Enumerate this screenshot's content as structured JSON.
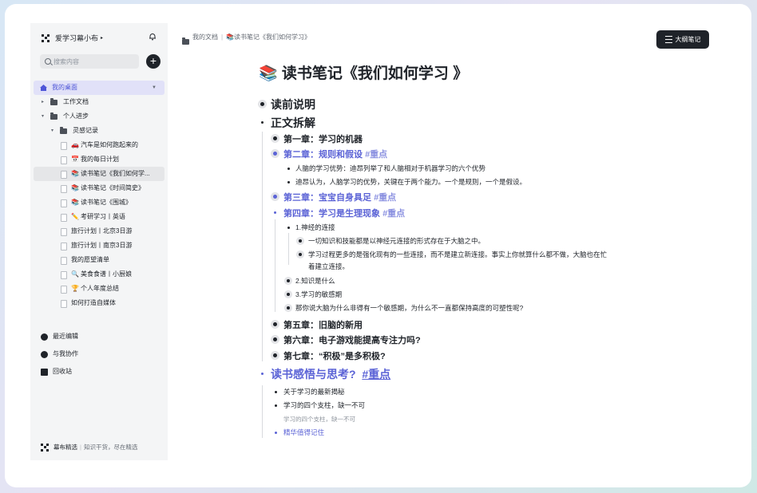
{
  "workspace": {
    "name": "爱学习幕小布",
    "caret": "▸"
  },
  "search": {
    "placeholder": "搜索内容"
  },
  "sidebar": {
    "desk": "我的桌面",
    "tree": [
      {
        "label": "工作文档",
        "emoji": ""
      },
      {
        "label": "个人进步",
        "emoji": ""
      },
      {
        "label": "灵感记录",
        "emoji": ""
      },
      {
        "label": "汽车是如何跑起来的",
        "emoji": "🚗"
      },
      {
        "label": "我的每日计划",
        "emoji": "📅"
      },
      {
        "label": "读书笔记《我们如何学...",
        "emoji": "📚"
      },
      {
        "label": "读书笔记《时间简史》",
        "emoji": "📚"
      },
      {
        "label": "读书笔记《围城》",
        "emoji": "📚"
      },
      {
        "label": "考研学习丨英语",
        "emoji": "✏️"
      },
      {
        "label": "旅行计划丨北京3日游",
        "emoji": ""
      },
      {
        "label": "旅行计划丨南京3日游",
        "emoji": ""
      },
      {
        "label": "我的愿望清单",
        "emoji": ""
      },
      {
        "label": "美食食谱丨小厨娘",
        "emoji": "🔍"
      },
      {
        "label": "个人年度总结",
        "emoji": "🏆"
      },
      {
        "label": "如何打造自媒体",
        "emoji": ""
      }
    ],
    "recent": "最近编辑",
    "collab": "与我协作",
    "trash": "回收站",
    "footer_brand": "幕布精选",
    "footer_slogan": "知识干货，尽在精选"
  },
  "breadcrumb": {
    "root": "我的文档",
    "current": "📚读书笔记《我们如何学习》"
  },
  "outline_button": "大纲笔记",
  "doc": {
    "title": "📚 读书笔记《我们如何学习 》",
    "pre": "读前说明",
    "body": "正文拆解",
    "ch1": "第一章：学习的机器",
    "ch2": "第二章：规则和假设",
    "ch2_tag": "#重点",
    "ch2_p1": "人脑的学习优势：迪昂列举了和人脑相对于机器学习的六个优势",
    "ch2_p2": "迪昂认为，人脑学习的优势，关键在于两个能力。一个是规则，一个是假设。",
    "ch3": "第三章：宝宝自身具足",
    "ch3_tag": "#重点",
    "ch4": "第四章：学习是生理现象",
    "ch4_tag": "#重点",
    "ch4_s1": "1.神经的连接",
    "ch4_s1_a": "一切知识和技能都是以神经元连接的形式存在于大脑之中。",
    "ch4_s1_b1": "学习过程更多的是强化现有的一些连接，而不是建立新连接。事实上你就算什么都不做，大脑也在忙",
    "ch4_s1_b2": "着建立连接。",
    "ch4_s2": "2.知识是什么",
    "ch4_s3": "3.学习的敏感期",
    "ch4_s4": "那你说大脑为什么非得有一个敏感期，为什么不一直都保持高度的可塑性呢?",
    "ch5": "第五章：旧脑的新用",
    "ch6": "第六章：电子游戏能提高专注力吗?",
    "ch7": "第七章：“积极”是多积极?",
    "reflect": "读书感悟与思考?",
    "reflect_tag": "#重点",
    "r1": "关于学习的最新揭秘",
    "r2": "学习的四个支柱，缺一不可",
    "r2_note": "学习的四个支柱，缺一不可",
    "r3": "精华值得记住"
  },
  "colors": {
    "accent": "#5b63d6",
    "tag": "#8a90e0",
    "active_bg": "#e1e1f8"
  }
}
